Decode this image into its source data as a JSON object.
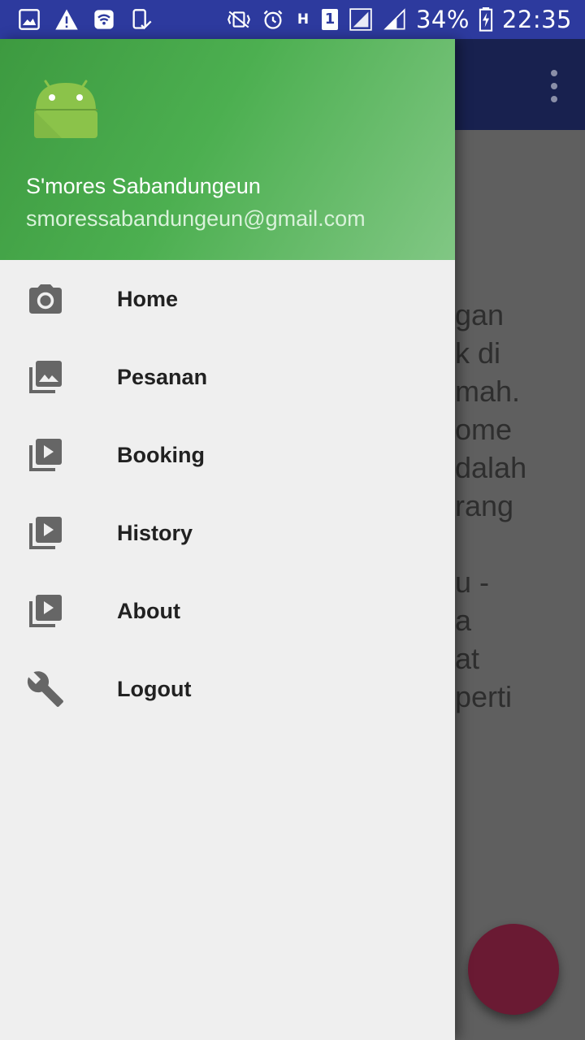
{
  "status_bar": {
    "battery": "34%",
    "time": "22:35",
    "network_type": "H",
    "sim_slot": "1"
  },
  "drawer": {
    "header": {
      "name": "S'mores Sabandungeun",
      "email": "smoressabandungeun@gmail.com"
    },
    "items": [
      {
        "label": "Home",
        "icon": "camera-icon"
      },
      {
        "label": "Pesanan",
        "icon": "gallery-icon"
      },
      {
        "label": "Booking",
        "icon": "video-library-icon"
      },
      {
        "label": "History",
        "icon": "video-library-icon"
      },
      {
        "label": "About",
        "icon": "video-library-icon"
      },
      {
        "label": "Logout",
        "icon": "wrench-icon"
      }
    ]
  },
  "background": {
    "lines": [
      "gan",
      "k di",
      "mah.",
      "ome",
      "dalah",
      "rang",
      "",
      "u -",
      "a",
      "at",
      "perti"
    ]
  },
  "colors": {
    "status_bar": "#2d3a9e",
    "app_bar": "#18214f",
    "header_green": "#4caf50",
    "fab": "#6a1a33",
    "drawer_bg": "#efefef"
  }
}
